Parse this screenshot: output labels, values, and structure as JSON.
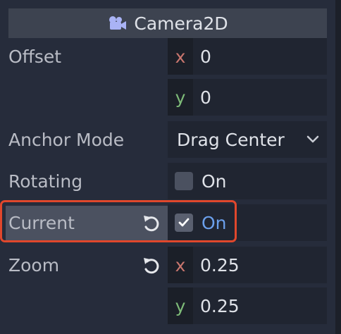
{
  "header": {
    "title": "Camera2D",
    "icon": "camera-icon"
  },
  "properties": {
    "offset": {
      "label": "Offset",
      "x_axis": "x",
      "x_value": "0",
      "y_axis": "y",
      "y_value": "0"
    },
    "anchor_mode": {
      "label": "Anchor Mode",
      "value": "Drag Center"
    },
    "rotating": {
      "label": "Rotating",
      "checked": false,
      "check_label": "On"
    },
    "current": {
      "label": "Current",
      "checked": true,
      "check_label": "On"
    },
    "zoom": {
      "label": "Zoom",
      "x_axis": "x",
      "x_value": "0.25",
      "y_axis": "y",
      "y_value": "0.25"
    }
  },
  "colors": {
    "axis_x": "#c9766e",
    "axis_y": "#7ebb78",
    "accent_on": "#6ba0ec",
    "highlight_border": "#e0472c"
  }
}
